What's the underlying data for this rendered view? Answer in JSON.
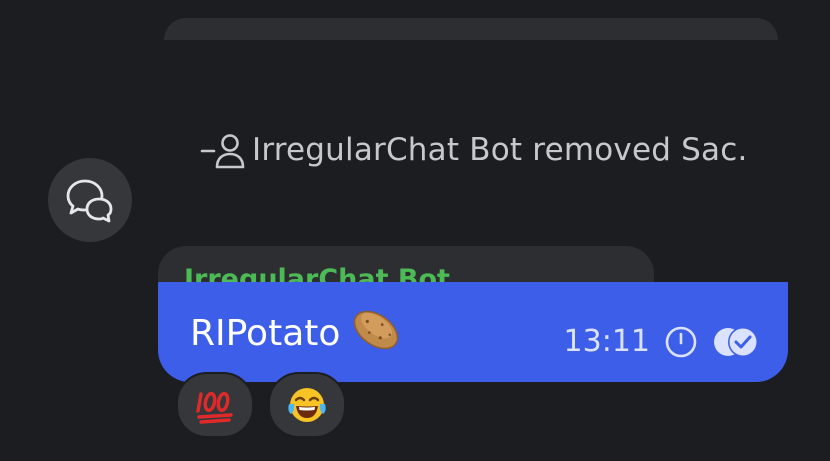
{
  "system_message": {
    "text": "IrregularChat Bot removed Sac.",
    "icon": "remove-person-icon"
  },
  "incoming_message": {
    "sender": "IrregularChat Bot"
  },
  "outgoing_message": {
    "text": "RIPotato",
    "emoji": "potato",
    "time": "13:11",
    "status_icons": [
      "clock-icon",
      "read-receipt-icon"
    ]
  },
  "reactions": [
    {
      "emoji": "hundred-points"
    },
    {
      "emoji": "face-with-tears-of-joy"
    }
  ],
  "side_button": {
    "icon": "chat-bubbles-icon"
  },
  "colors": {
    "background": "#1c1d20",
    "bubble_outgoing": "#3d5ee8",
    "bubble_incoming": "#2d2e32",
    "sender_name": "#4cbb55"
  }
}
